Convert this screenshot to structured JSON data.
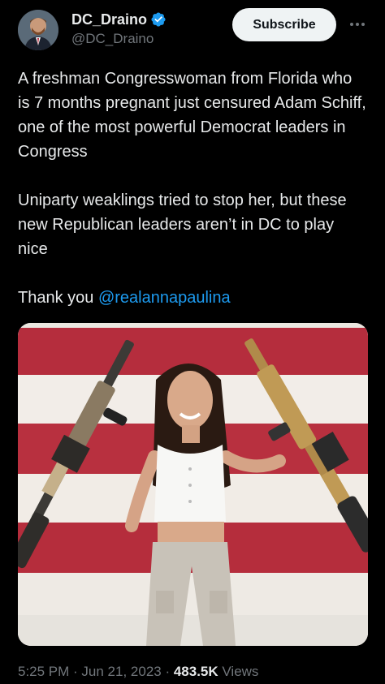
{
  "author": {
    "display_name": "DC_Draino",
    "handle": "@DC_Draino",
    "verified": true,
    "verified_color": "#1d9bf0"
  },
  "header": {
    "subscribe_label": "Subscribe",
    "more_icon": "more-horizontal-icon"
  },
  "tweet": {
    "paragraph1": "A freshman Congresswoman from Florida who is 7 months pregnant just censured Adam Schiff, one of the most powerful Democrat leaders in Congress",
    "paragraph2": "Uniparty weaklings tried to stop her, but these new Republican leaders aren’t in DC to play nice",
    "thanks_prefix": "Thank you ",
    "mention": "@realannapaulina"
  },
  "meta": {
    "time": "5:25 PM",
    "separator": " · ",
    "date": "Jun 21, 2023",
    "views_count": "483.5K",
    "views_label": " Views"
  },
  "colors": {
    "background": "#000000",
    "text_primary": "#e7e9ea",
    "text_secondary": "#71767b",
    "accent": "#1d9bf0"
  }
}
